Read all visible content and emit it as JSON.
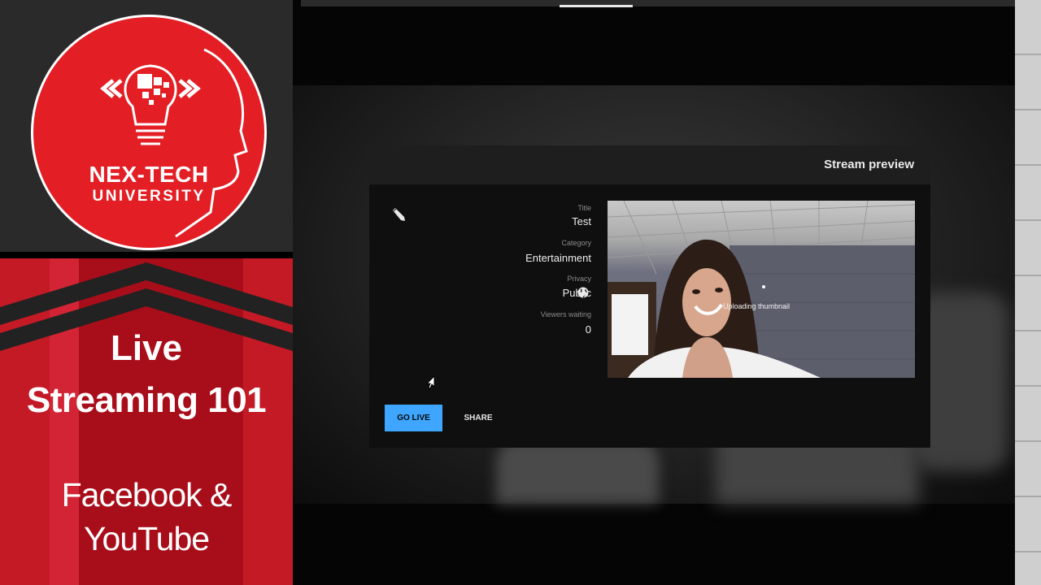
{
  "branding": {
    "logo_line1": "NEX-TECH",
    "logo_line2": "UNIVERSITY",
    "title_line1": "Live",
    "title_line2": "Streaming 101",
    "subtitle_line1": "Facebook &",
    "subtitle_line2": "YouTube"
  },
  "colors": {
    "brand_red": "#e31e24",
    "accent_blue": "#3ea6ff",
    "dialog_bg": "#0f0f0f"
  },
  "dialog": {
    "title": "Stream preview",
    "thumbnail_status": "Uploading thumbnail",
    "fields": {
      "title_label": "Title",
      "title_value": "Test",
      "category_label": "Category",
      "category_value": "Entertainment",
      "privacy_label": "Privacy",
      "privacy_value": "Public",
      "viewers_label": "Viewers waiting",
      "viewers_value": "0"
    },
    "buttons": {
      "share": "SHARE",
      "go_live": "GO LIVE"
    },
    "icons": {
      "edit": "pencil-icon",
      "privacy": "globe-icon",
      "pointer": "cursor-icon"
    }
  }
}
